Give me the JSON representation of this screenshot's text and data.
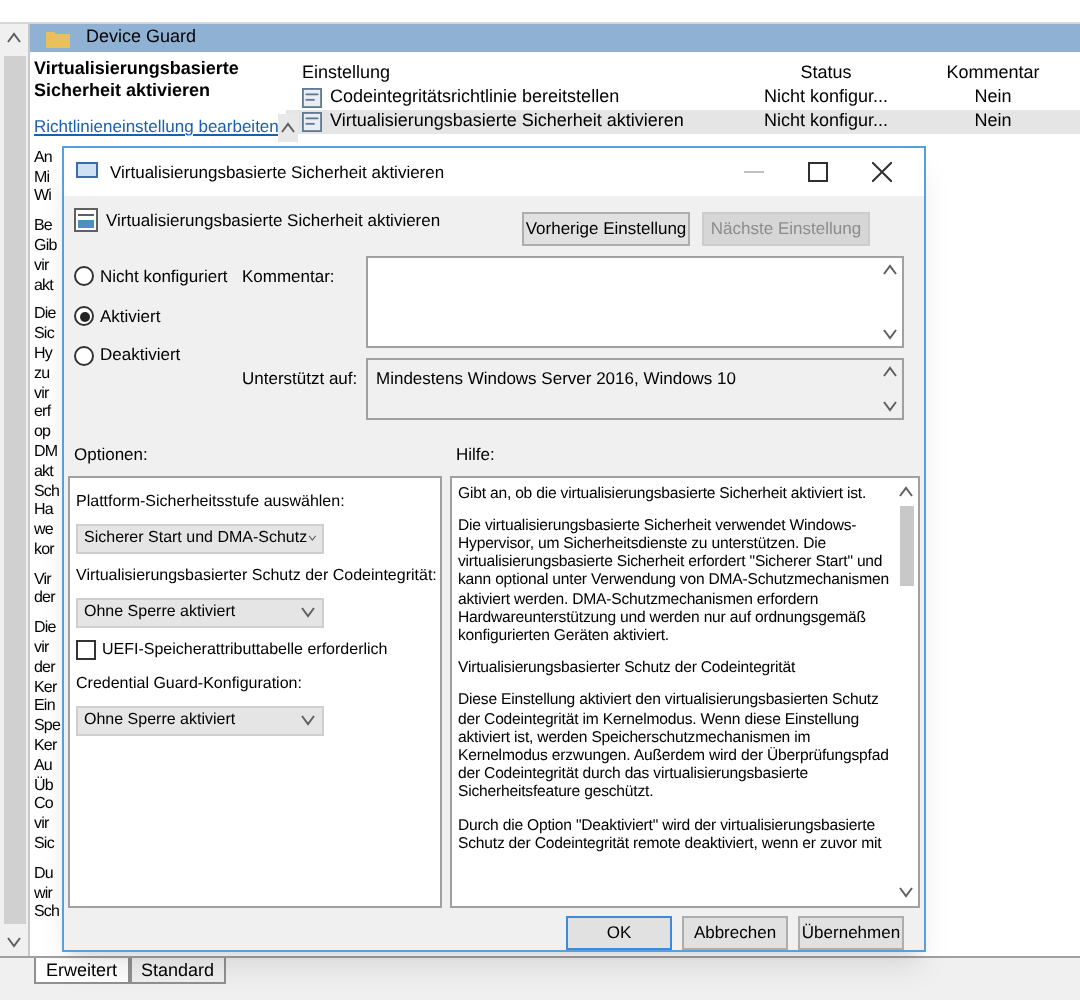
{
  "tree_header": {
    "title": "Device Guard"
  },
  "description": {
    "title": "Virtualisierungsbasierte Sicherheit aktivieren",
    "link": "Richtlinieneinstellung bearbeiten",
    "paragraphs": [
      [
        "An",
        "Mi",
        "Wi"
      ],
      [
        "Be",
        "Gib",
        "vir",
        "akt"
      ],
      [
        "Die",
        "Sic",
        "Hy",
        "zu",
        "vir",
        "erf",
        "op",
        "DM",
        "akt",
        "Sch",
        "Ha",
        "we",
        "kor"
      ],
      [
        "Vir",
        "der"
      ],
      [
        "Die",
        "vir",
        "der",
        "Ker",
        "Ein",
        "Spe",
        "Ker",
        "Au",
        "Üb",
        "Co",
        "vir",
        "Sic"
      ],
      [
        "Du",
        "wir",
        "Sch"
      ]
    ]
  },
  "table": {
    "columns": [
      "Einstellung",
      "Status",
      "Kommentar"
    ],
    "rows": [
      {
        "setting": "Codeintegritätsrichtlinie bereitstellen",
        "status": "Nicht konfigur...",
        "comment": "Nein",
        "selected": false
      },
      {
        "setting": "Virtualisierungsbasierte Sicherheit aktivieren",
        "status": "Nicht konfigur...",
        "comment": "Nein",
        "selected": true
      }
    ]
  },
  "dialog": {
    "title": "Virtualisierungsbasierte Sicherheit aktivieren",
    "heading": "Virtualisierungsbasierte Sicherheit aktivieren",
    "nav_buttons": [
      {
        "label": "Vorherige Einstellung",
        "disabled": false
      },
      {
        "label": "Nächste Einstellung",
        "disabled": true
      }
    ],
    "radios": [
      {
        "label": "Nicht konfiguriert",
        "selected": false
      },
      {
        "label": "Aktiviert",
        "selected": true
      },
      {
        "label": "Deaktiviert",
        "selected": false
      }
    ],
    "comment_label": "Kommentar:",
    "supported_label": "Unterstützt auf:",
    "supported_value": "Mindestens Windows Server 2016, Windows 10",
    "options_label": "Optionen:",
    "help_label": "Hilfe:",
    "options": [
      {
        "kind": "label",
        "text": "Plattform-Sicherheitsstufe auswählen:"
      },
      {
        "kind": "dropdown",
        "text": "Sicherer Start und DMA-Schutz"
      },
      {
        "kind": "label",
        "text": "Virtualisierungsbasierter Schutz der Codeintegrität:"
      },
      {
        "kind": "dropdown",
        "text": "Ohne Sperre aktiviert"
      },
      {
        "kind": "checkbox",
        "text": "UEFI-Speicherattributtabelle erforderlich",
        "checked": false
      },
      {
        "kind": "label",
        "text": "Credential Guard-Konfiguration:"
      },
      {
        "kind": "dropdown",
        "text": "Ohne Sperre aktiviert"
      }
    ],
    "help_paragraphs": [
      "Gibt an, ob die virtualisierungsbasierte Sicherheit aktiviert ist.",
      "Die virtualisierungsbasierte Sicherheit verwendet Windows-Hypervisor, um Sicherheitsdienste zu unterstützen. Die virtualisierungsbasierte Sicherheit erfordert \"Sicherer Start\" und kann optional unter Verwendung von DMA-Schutzmechanismen aktiviert werden. DMA-Schutzmechanismen erfordern Hardwareunterstützung und werden nur auf ordnungsgemäß konfigurierten Geräten aktiviert.",
      "Virtualisierungsbasierter Schutz der Codeintegrität",
      "Diese Einstellung aktiviert den virtualisierungsbasierten Schutz der Codeintegrität im Kernelmodus. Wenn diese Einstellung aktiviert ist, werden Speicherschutzmechanismen im Kernelmodus erzwungen. Außerdem wird der Überprüfungspfad der Codeintegrität durch das virtualisierungsbasierte Sicherheitsfeature geschützt.",
      "Durch die Option \"Deaktiviert\" wird der virtualisierungsbasierte Schutz der Codeintegrität remote deaktiviert, wenn er zuvor mit"
    ],
    "buttons": [
      {
        "label": "OK",
        "default": true
      },
      {
        "label": "Abbrechen",
        "default": false
      },
      {
        "label": "Übernehmen",
        "default": false
      }
    ]
  },
  "bottom_tabs": [
    {
      "label": "Erweitert",
      "selected": true
    },
    {
      "label": "Standard",
      "selected": false
    }
  ]
}
